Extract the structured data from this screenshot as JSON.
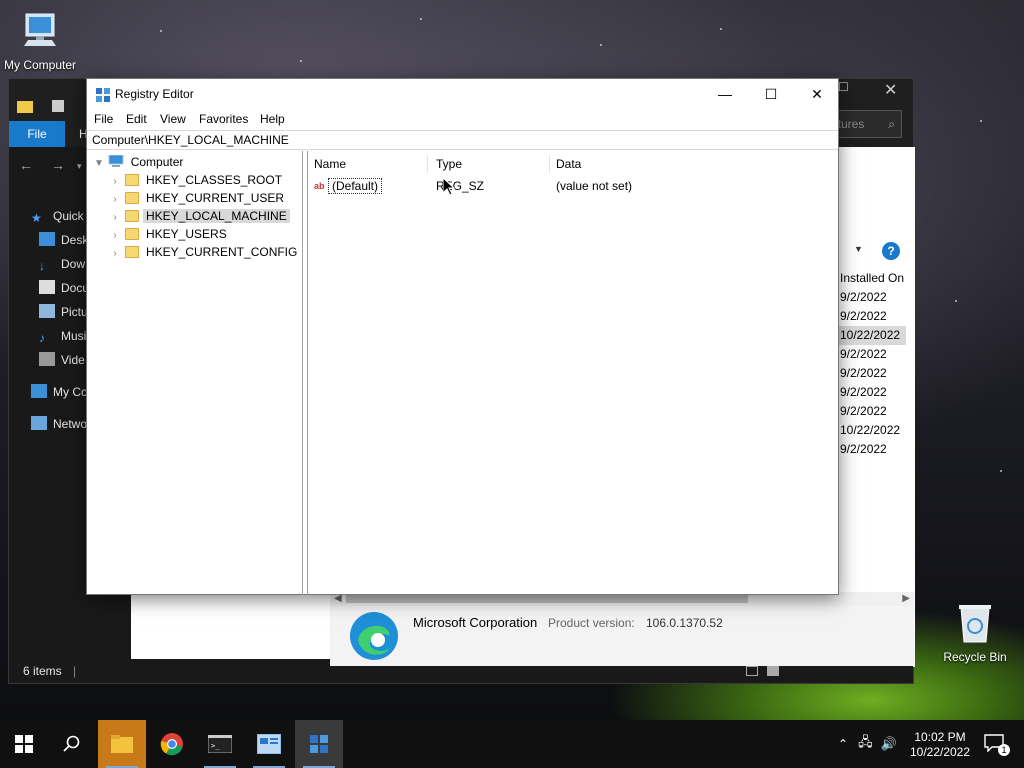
{
  "desktop": {
    "icons": [
      {
        "label": "My Computer"
      },
      {
        "label": "Recycle Bin"
      }
    ]
  },
  "explorer": {
    "file_tab": "File",
    "home_tab": "H",
    "search_placeholder": "atures",
    "nav_items": [
      "Quick",
      "Desk",
      "Dow",
      "Docu",
      "Pictu",
      "Musi",
      "Vide",
      "My Co",
      "Netwo"
    ],
    "status": "6 items",
    "installed_header": "Installed On",
    "installed_dates": [
      "9/2/2022",
      "9/2/2022",
      "10/22/2022",
      "9/2/2022",
      "9/2/2022",
      "9/2/2022",
      "9/2/2022",
      "10/22/2022",
      "9/2/2022"
    ],
    "publisher": "Microsoft Corporation",
    "product_version_label": "Product version:",
    "product_version": "106.0.1370.52"
  },
  "regedit": {
    "title": "Registry Editor",
    "menu": [
      "File",
      "Edit",
      "View",
      "Favorites",
      "Help"
    ],
    "address": "Computer\\HKEY_LOCAL_MACHINE",
    "tree_root": "Computer",
    "tree_items": [
      "HKEY_CLASSES_ROOT",
      "HKEY_CURRENT_USER",
      "HKEY_LOCAL_MACHINE",
      "HKEY_USERS",
      "HKEY_CURRENT_CONFIG"
    ],
    "selected_key": "HKEY_LOCAL_MACHINE",
    "columns": {
      "name": "Name",
      "type": "Type",
      "data": "Data"
    },
    "values": [
      {
        "name": "(Default)",
        "type": "REG_SZ",
        "data": "(value not set)"
      }
    ]
  },
  "taskbar": {
    "time": "10:02 PM",
    "date": "10/22/2022",
    "notification_count": "1",
    "apps": [
      "start-icon",
      "search-icon",
      "file-explorer-icon",
      "chrome-icon",
      "terminal-icon",
      "control-panel-icon",
      "regedit-icon"
    ]
  },
  "colors": {
    "accent": "#1979ca",
    "selection": "#d9d9d9"
  }
}
